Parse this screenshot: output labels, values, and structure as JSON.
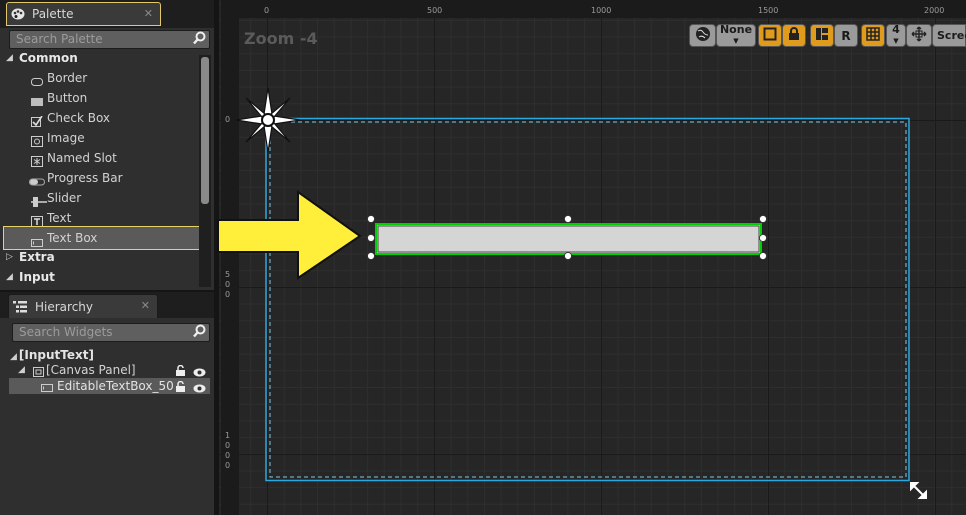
{
  "palette": {
    "tab_label": "Palette",
    "search_placeholder": "Search Palette",
    "categories": {
      "common": "Common",
      "extra": "Extra",
      "input": "Input"
    },
    "items": [
      {
        "label": "Border",
        "icon": "border-icon"
      },
      {
        "label": "Button",
        "icon": "button-icon"
      },
      {
        "label": "Check Box",
        "icon": "checkbox-icon"
      },
      {
        "label": "Image",
        "icon": "image-icon"
      },
      {
        "label": "Named Slot",
        "icon": "named-slot-icon"
      },
      {
        "label": "Progress Bar",
        "icon": "progress-bar-icon"
      },
      {
        "label": "Slider",
        "icon": "slider-icon"
      },
      {
        "label": "Text",
        "icon": "text-icon"
      },
      {
        "label": "Text Box",
        "icon": "text-box-icon"
      }
    ],
    "selected_item": "Text Box"
  },
  "hierarchy": {
    "tab_label": "Hierarchy",
    "search_placeholder": "Search Widgets",
    "root": "[InputText]",
    "canvas": "[Canvas Panel]",
    "child": "EditableTextBox_50"
  },
  "designer": {
    "zoom_label": "Zoom -4",
    "toolbar": {
      "none_label": "None",
      "r_label": "R",
      "grid_count": "4",
      "screen_label": "Scree"
    },
    "ruler_top_ticks": [
      "0",
      "500",
      "1000",
      "1500",
      "2000"
    ],
    "ruler_left_ticks": [
      "0",
      "5\n0\n0",
      "1\n0\n0\n0"
    ]
  },
  "colors": {
    "accent_yellow": "#ffef3b",
    "selection_green": "#00d000",
    "canvas_blue": "#2aa8e0",
    "tab_highlight": "#e2c86a"
  }
}
